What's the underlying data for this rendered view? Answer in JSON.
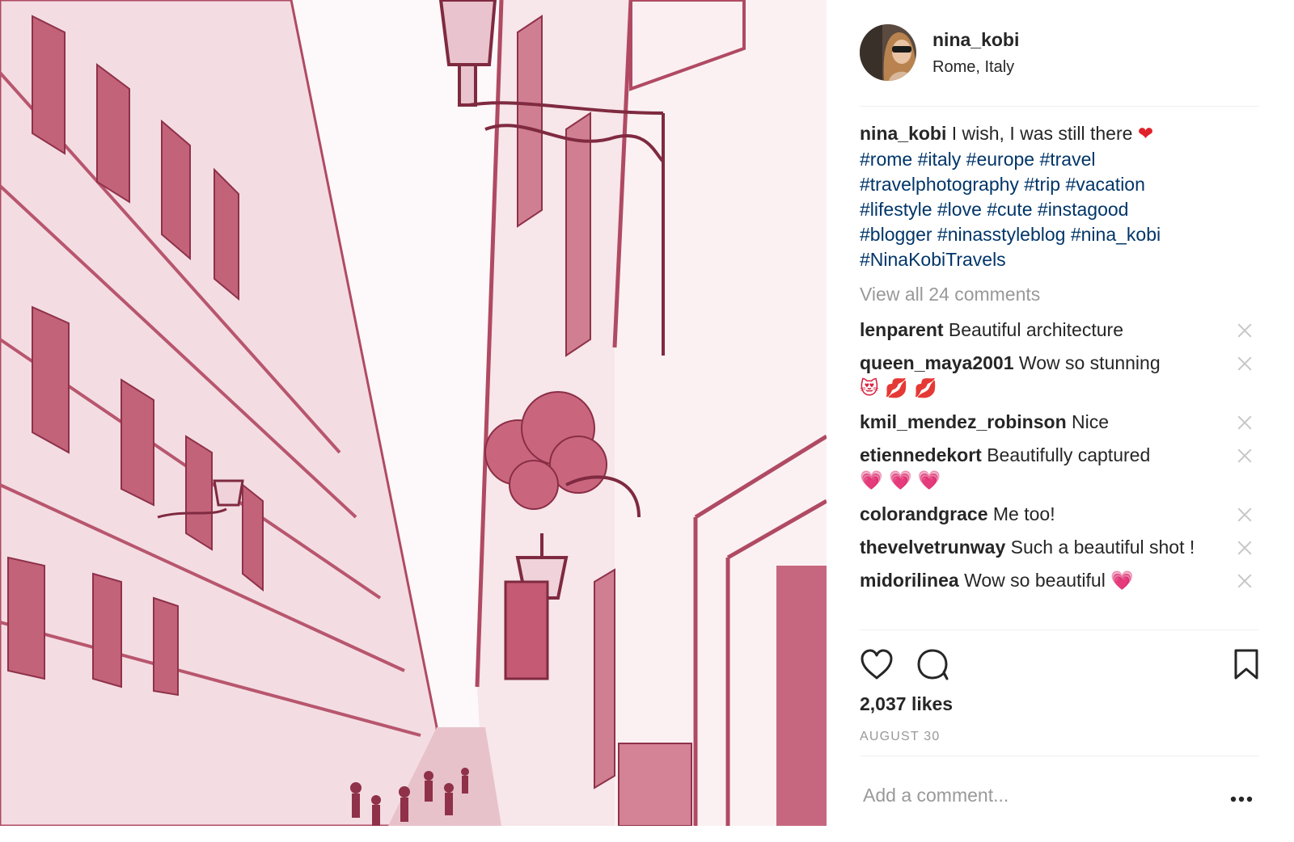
{
  "post": {
    "username": "nina_kobi",
    "location": "Rome, Italy",
    "caption_user": "nina_kobi",
    "caption_text": "I wish, I was still there",
    "caption_emoji": "❤",
    "hashtags_line1": "#rome #italy #europe #travel",
    "hashtags_line2": "#travelphotography #trip #vacation",
    "hashtags_line3": "#lifestyle #love #cute #instagood",
    "hashtags_line4": "#blogger #ninasstyleblog #nina_kobi",
    "hashtags_line5": "#NinaKobiTravels",
    "view_all_comments": "View all 24 comments",
    "likes": "2,037 likes",
    "date": "AUGUST 30",
    "add_comment_placeholder": "Add a comment..."
  },
  "comments": [
    {
      "user": "lenparent",
      "text": "Beautiful architecture",
      "emoji": ""
    },
    {
      "user": "queen_maya2001",
      "text": "Wow so stunning",
      "emoji": "😻 💋 💋"
    },
    {
      "user": "kmil_mendez_robinson",
      "text": "Nice",
      "emoji": ""
    },
    {
      "user": "etiennedekort",
      "text": "Beautifully captured",
      "emoji": "💗 💗 💗"
    },
    {
      "user": "colorandgrace",
      "text": "Me too!",
      "emoji": ""
    },
    {
      "user": "thevelvetrunway",
      "text": "Such a beautiful shot !",
      "emoji": ""
    },
    {
      "user": "midorilinea",
      "text": "Wow so beautiful",
      "emoji": "💗"
    }
  ],
  "icons": {
    "like": "heart-outline-icon",
    "comment": "speech-bubble-icon",
    "save": "bookmark-icon",
    "more": "more-options-icon",
    "delete": "close-icon"
  },
  "colors": {
    "hashtag": "#003569",
    "secondary_text": "#999999",
    "photo_tint": "#b04a63"
  }
}
